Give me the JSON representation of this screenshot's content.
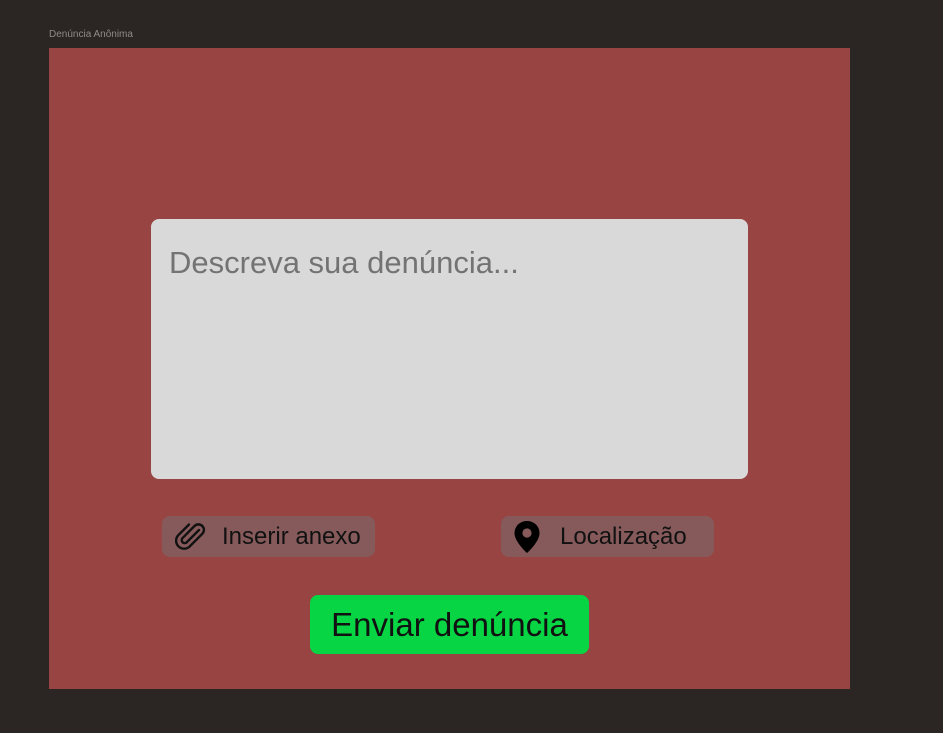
{
  "frame": {
    "label": "Denúncia Anônima"
  },
  "report": {
    "placeholder": "Descreva sua denúncia..."
  },
  "actions": {
    "attach_label": "Inserir anexo",
    "attach_icon": "paperclip-icon",
    "location_label": "Localização",
    "location_icon": "map-pin-icon",
    "submit_label": "Enviar denúncia"
  },
  "colors": {
    "background": "#2b2624",
    "frame": "#974442",
    "textarea": "#d9d9d9",
    "chip": "#865a5b",
    "submit": "#07d543"
  }
}
